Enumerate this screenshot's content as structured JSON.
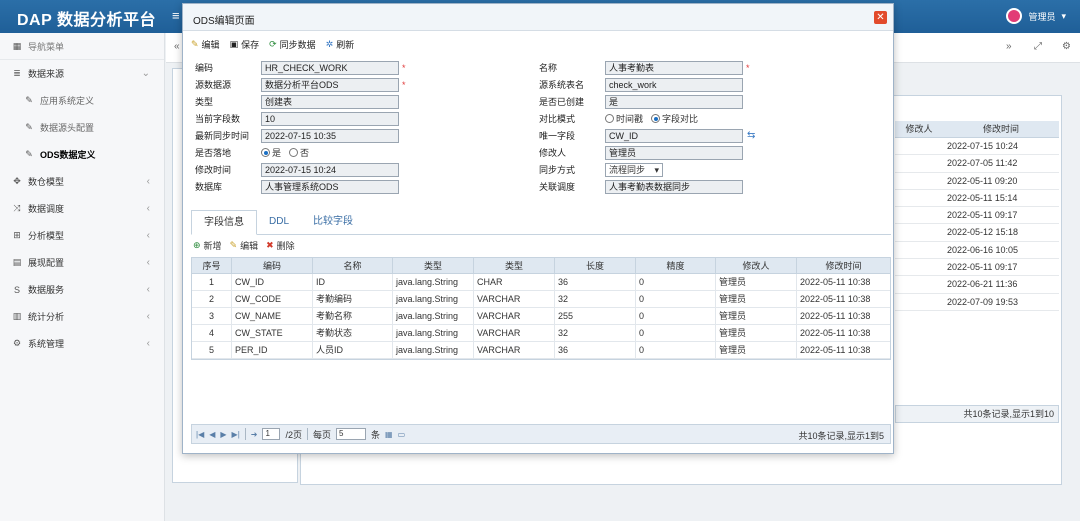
{
  "app": {
    "title": "DAP 数据分析平台",
    "menu_glyph": "≡",
    "user_name": "管理员"
  },
  "sidebar": {
    "header": "导航菜单",
    "items": [
      {
        "label": "数据来源",
        "icon": "stack-icon",
        "glyph": "≣",
        "expanded": true
      },
      {
        "label": "应用系统定义",
        "sub": true
      },
      {
        "label": "数据源头配置",
        "sub": true
      },
      {
        "label": "ODS数据定义",
        "sub": true,
        "active": true
      },
      {
        "label": "数仓模型",
        "glyph": "✥"
      },
      {
        "label": "数据调度",
        "glyph": "⤨"
      },
      {
        "label": "分析模型",
        "glyph": "⊞"
      },
      {
        "label": "展现配置",
        "glyph": "▤"
      },
      {
        "label": "数据服务",
        "glyph": "S"
      },
      {
        "label": "统计分析",
        "glyph": "▥"
      },
      {
        "label": "系统管理",
        "glyph": "⚙"
      }
    ]
  },
  "background_table": {
    "headers": [
      "修改人",
      "修改时间"
    ],
    "rows": [
      "2022-07-15 10:24",
      "2022-07-05 11:42",
      "2022-05-11 09:20",
      "2022-05-11 15:14",
      "2022-05-11 09:17",
      "2022-05-12 15:18",
      "2022-06-16 10:05",
      "2022-05-11 09:17",
      "2022-06-21 11:36",
      "2022-07-09 19:53"
    ],
    "footer": "共10条记录,显示1到10"
  },
  "modal": {
    "title": "ODS编辑页面",
    "close": "✕",
    "toolbar": [
      {
        "label": "编辑",
        "icon": "pencil-icon",
        "glyph": "✎"
      },
      {
        "label": "保存",
        "icon": "save-icon",
        "glyph": "▣"
      },
      {
        "label": "同步数据",
        "icon": "sync-icon",
        "glyph": "⟳"
      },
      {
        "label": "刷新",
        "icon": "refresh-icon",
        "glyph": "✲"
      }
    ],
    "form": {
      "code_label": "编码",
      "code": "HR_CHECK_WORK",
      "name_label": "名称",
      "name": "人事考勤表",
      "source_label": "源数据源",
      "source": "数据分析平台ODS",
      "source_table_label": "源系统表名",
      "source_table": "check_work",
      "type_label": "类型",
      "type": "创建表",
      "created_label": "是否已创建",
      "created": "是",
      "field_count_label": "当前字段数",
      "field_count": "10",
      "compare_label": "对比模式",
      "compare_opt1": "时间戳",
      "compare_opt2": "字段对比",
      "last_sync_label": "最新同步时间",
      "last_sync": "2022-07-15 10:35",
      "unique_label": "唯一字段",
      "unique": "CW_ID",
      "landing_label": "是否落地",
      "landing_yes": "是",
      "landing_no": "否",
      "modifier_label": "修改人",
      "modifier": "管理员",
      "modified_label": "修改时间",
      "modified": "2022-07-15 10:24",
      "sync_mode_label": "同步方式",
      "sync_mode": "流程同步",
      "db_label": "数据库",
      "db": "人事管理系统ODS",
      "schedule_label": "关联调度",
      "schedule": "人事考勤表数据同步",
      "required_mark": "*"
    },
    "tabs": [
      "字段信息",
      "DDL",
      "比较字段"
    ],
    "subbar": [
      {
        "label": "新增",
        "glyph": "⊕"
      },
      {
        "label": "编辑",
        "glyph": "✎"
      },
      {
        "label": "删除",
        "glyph": "✖"
      }
    ],
    "grid": {
      "headers": [
        "序号",
        "编码",
        "名称",
        "类型",
        "类型",
        "长度",
        "精度",
        "修改人",
        "修改时间"
      ],
      "rows": [
        [
          "1",
          "CW_ID",
          "ID",
          "java.lang.String",
          "CHAR",
          "36",
          "0",
          "管理员",
          "2022-05-11 10:38"
        ],
        [
          "2",
          "CW_CODE",
          "考勤编码",
          "java.lang.String",
          "VARCHAR",
          "32",
          "0",
          "管理员",
          "2022-05-11 10:38"
        ],
        [
          "3",
          "CW_NAME",
          "考勤名称",
          "java.lang.String",
          "VARCHAR",
          "255",
          "0",
          "管理员",
          "2022-05-11 10:38"
        ],
        [
          "4",
          "CW_STATE",
          "考勤状态",
          "java.lang.String",
          "VARCHAR",
          "32",
          "0",
          "管理员",
          "2022-05-11 10:38"
        ],
        [
          "5",
          "PER_ID",
          "人员ID",
          "java.lang.String",
          "VARCHAR",
          "36",
          "0",
          "管理员",
          "2022-05-11 10:38"
        ]
      ]
    },
    "pager": {
      "page": "1",
      "total_pages": "/2页",
      "per_page_label": "每页",
      "per_page": "5",
      "unit": "条",
      "info": "共10条记录,显示1到5"
    }
  }
}
